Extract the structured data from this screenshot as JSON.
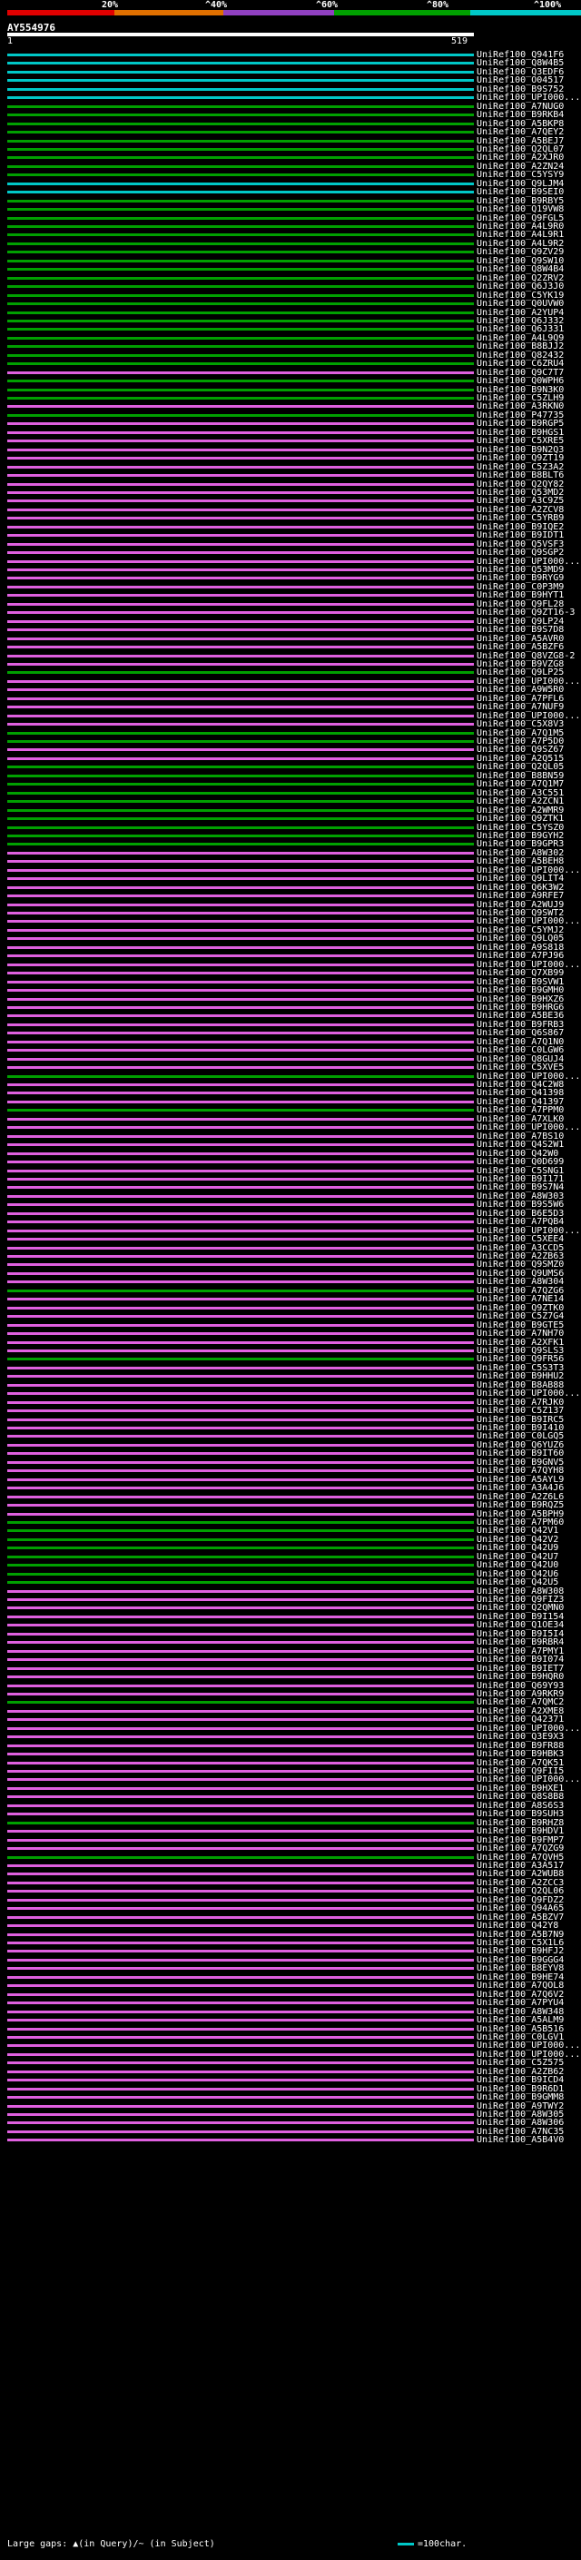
{
  "scale": {
    "labels": [
      "20%",
      "^40%",
      "^60%",
      "^80%",
      "^100%"
    ],
    "colors": [
      "#e00000",
      "#e07000",
      "#9040c0",
      "#00a000",
      "#00c8c8"
    ]
  },
  "query": {
    "name": "AY554976",
    "start": "1",
    "end": "519"
  },
  "hits": [
    {
      "label": "UniRef100_Q941F6",
      "color": "#00c8c8"
    },
    {
      "label": "UniRef100_Q8W4B5",
      "color": "#00c8c8"
    },
    {
      "label": "UniRef100_Q3EDF6",
      "color": "#00c8c8"
    },
    {
      "label": "UniRef100_O04517",
      "color": "#00c8c8"
    },
    {
      "label": "UniRef100_B9S752",
      "color": "#00c8c8"
    },
    {
      "label": "UniRef100_UPI000...",
      "color": "#00c8c8"
    },
    {
      "label": "UniRef100_A7NUG0",
      "color": "#00a000"
    },
    {
      "label": "UniRef100_B9RKB4",
      "color": "#00a000"
    },
    {
      "label": "UniRef100_A5BKP8",
      "color": "#00a000"
    },
    {
      "label": "UniRef100_A7QEY2",
      "color": "#00a000"
    },
    {
      "label": "UniRef100_A5BEJ7",
      "color": "#00a000"
    },
    {
      "label": "UniRef100_Q2QL07",
      "color": "#00a000"
    },
    {
      "label": "UniRef100_A2XJR0",
      "color": "#00a000"
    },
    {
      "label": "UniRef100_A2ZN24",
      "color": "#00a000"
    },
    {
      "label": "UniRef100_C5YSY9",
      "color": "#00a000"
    },
    {
      "label": "UniRef100_Q9LJM4",
      "color": "#00c8c8"
    },
    {
      "label": "UniRef100_B9SEI0",
      "color": "#00c8c8"
    },
    {
      "label": "UniRef100_B9RBY5",
      "color": "#00a000"
    },
    {
      "label": "UniRef100_Q19VW8",
      "color": "#00a000"
    },
    {
      "label": "UniRef100_Q9FGL5",
      "color": "#00a000"
    },
    {
      "label": "UniRef100_A4L9R0",
      "color": "#00a000"
    },
    {
      "label": "UniRef100_A4L9R1",
      "color": "#00a000"
    },
    {
      "label": "UniRef100_A4L9R2",
      "color": "#00a000"
    },
    {
      "label": "UniRef100_Q9ZV29",
      "color": "#00a000"
    },
    {
      "label": "UniRef100_Q9SW10",
      "color": "#00a000"
    },
    {
      "label": "UniRef100_Q8W4B4",
      "color": "#00a000"
    },
    {
      "label": "UniRef100_Q2ZRV2",
      "color": "#00a000"
    },
    {
      "label": "UniRef100_Q6J3J0",
      "color": "#00a000"
    },
    {
      "label": "UniRef100_C5YK19",
      "color": "#00a000"
    },
    {
      "label": "UniRef100_Q0UVW0",
      "color": "#00a000"
    },
    {
      "label": "UniRef100_A2YUP4",
      "color": "#00a000"
    },
    {
      "label": "UniRef100_Q6J332",
      "color": "#00a000"
    },
    {
      "label": "UniRef100_Q6J331",
      "color": "#00a000"
    },
    {
      "label": "UniRef100_A4L9Q9",
      "color": "#00a000"
    },
    {
      "label": "UniRef100_B8BJJ2",
      "color": "#00a000"
    },
    {
      "label": "UniRef100_Q82432",
      "color": "#00a000"
    },
    {
      "label": "UniRef100_C6ZRU4",
      "color": "#00a000"
    },
    {
      "label": "UniRef100_Q9C7T7",
      "color": "#e060e0"
    },
    {
      "label": "UniRef100_Q0WPH6",
      "color": "#00a000"
    },
    {
      "label": "UniRef100_B9N3K0",
      "color": "#00a000"
    },
    {
      "label": "UniRef100_C5ZLH9",
      "color": "#00a000"
    },
    {
      "label": "UniRef100_A3RKN0",
      "color": "#e060e0"
    },
    {
      "label": "UniRef100_P47735",
      "color": "#00a000"
    },
    {
      "label": "UniRef100_B9RGP5",
      "color": "#e060e0"
    },
    {
      "label": "UniRef100_B9HGS1",
      "color": "#e060e0"
    },
    {
      "label": "UniRef100_C5XRE5",
      "color": "#e060e0"
    },
    {
      "label": "UniRef100_B9N2Q3",
      "color": "#e060e0"
    },
    {
      "label": "UniRef100_Q9ZT19",
      "color": "#e060e0"
    },
    {
      "label": "UniRef100_C5Z3A2",
      "color": "#e060e0"
    },
    {
      "label": "UniRef100_B8BLT6",
      "color": "#e060e0"
    },
    {
      "label": "UniRef100_Q2QY82",
      "color": "#e060e0"
    },
    {
      "label": "UniRef100_Q53MD2",
      "color": "#e060e0"
    },
    {
      "label": "UniRef100_A3C9Z5",
      "color": "#e060e0"
    },
    {
      "label": "UniRef100_A2ZCV8",
      "color": "#e060e0"
    },
    {
      "label": "UniRef100_C5YRB9",
      "color": "#e060e0"
    },
    {
      "label": "UniRef100_B9IQE2",
      "color": "#e060e0"
    },
    {
      "label": "UniRef100_B9IDT1",
      "color": "#e060e0"
    },
    {
      "label": "UniRef100_Q5VSF3",
      "color": "#e060e0"
    },
    {
      "label": "UniRef100_Q9SGP2",
      "color": "#e060e0"
    },
    {
      "label": "UniRef100_UPI000...",
      "color": "#e060e0"
    },
    {
      "label": "UniRef100_Q53MD9",
      "color": "#e060e0"
    },
    {
      "label": "UniRef100_B9RYG9",
      "color": "#e060e0"
    },
    {
      "label": "UniRef100_C0P3M9",
      "color": "#e060e0"
    },
    {
      "label": "UniRef100_B9HYT1",
      "color": "#e060e0"
    },
    {
      "label": "UniRef100_Q9FL28",
      "color": "#e060e0"
    },
    {
      "label": "UniRef100_Q9ZT16-3",
      "color": "#e060e0"
    },
    {
      "label": "UniRef100_Q9LP24",
      "color": "#e060e0"
    },
    {
      "label": "UniRef100_B9S7D8",
      "color": "#e060e0"
    },
    {
      "label": "UniRef100_A5AVR0",
      "color": "#e060e0"
    },
    {
      "label": "UniRef100_A5BZF6",
      "color": "#e060e0"
    },
    {
      "label": "UniRef100_Q8VZG8-2",
      "color": "#e060e0"
    },
    {
      "label": "UniRef100_B9VZG8",
      "color": "#e060e0"
    },
    {
      "label": "UniRef100_Q9LP25",
      "color": "#00a000"
    },
    {
      "label": "UniRef100_UPI000...",
      "color": "#e060e0"
    },
    {
      "label": "UniRef100_A9W5R0",
      "color": "#e060e0"
    },
    {
      "label": "UniRef100_A7PFL6",
      "color": "#e060e0"
    },
    {
      "label": "UniRef100_A7NUF9",
      "color": "#e060e0"
    },
    {
      "label": "UniRef100_UPI000...",
      "color": "#e060e0"
    },
    {
      "label": "UniRef100_C5X8V3",
      "color": "#e060e0"
    },
    {
      "label": "UniRef100_A7Q1M5",
      "color": "#00a000"
    },
    {
      "label": "UniRef100_A7P5D0",
      "color": "#00a000"
    },
    {
      "label": "UniRef100_Q9SZ67",
      "color": "#e060e0"
    },
    {
      "label": "UniRef100_A2Q515",
      "color": "#e060e0"
    },
    {
      "label": "UniRef100_Q2QL05",
      "color": "#00a000"
    },
    {
      "label": "UniRef100_B8BN59",
      "color": "#00a000"
    },
    {
      "label": "UniRef100_A7Q1M7",
      "color": "#00a000"
    },
    {
      "label": "UniRef100_A3C551",
      "color": "#00a000"
    },
    {
      "label": "UniRef100_A2ZCN1",
      "color": "#00a000"
    },
    {
      "label": "UniRef100_A2WMR9",
      "color": "#00a000"
    },
    {
      "label": "UniRef100_Q9ZTK1",
      "color": "#00a000"
    },
    {
      "label": "UniRef100_C5YSZ0",
      "color": "#00a000"
    },
    {
      "label": "UniRef100_B9GYH2",
      "color": "#00a000"
    },
    {
      "label": "UniRef100_B9GPR3",
      "color": "#00a000"
    },
    {
      "label": "UniRef100_A8W302",
      "color": "#e060e0"
    },
    {
      "label": "UniRef100_A5BEH8",
      "color": "#e060e0"
    },
    {
      "label": "UniRef100_UPI000...",
      "color": "#e060e0"
    },
    {
      "label": "UniRef100_Q9LIT4",
      "color": "#e060e0"
    },
    {
      "label": "UniRef100_Q6K3W2",
      "color": "#e060e0"
    },
    {
      "label": "UniRef100_A9RFE7",
      "color": "#e060e0"
    },
    {
      "label": "UniRef100_A2WUJ9",
      "color": "#e060e0"
    },
    {
      "label": "UniRef100_Q9SWT2",
      "color": "#e060e0"
    },
    {
      "label": "UniRef100_UPI000...",
      "color": "#e060e0"
    },
    {
      "label": "UniRef100_C5YMJ2",
      "color": "#e060e0"
    },
    {
      "label": "UniRef100_Q9LQ05",
      "color": "#e060e0"
    },
    {
      "label": "UniRef100_A9S818",
      "color": "#e060e0"
    },
    {
      "label": "UniRef100_A7PJ96",
      "color": "#e060e0"
    },
    {
      "label": "UniRef100_UPI000...",
      "color": "#e060e0"
    },
    {
      "label": "UniRef100_Q7XB99",
      "color": "#e060e0"
    },
    {
      "label": "UniRef100_B9SVW1",
      "color": "#e060e0"
    },
    {
      "label": "UniRef100_B9GMH0",
      "color": "#e060e0"
    },
    {
      "label": "UniRef100_B9HXZ6",
      "color": "#e060e0"
    },
    {
      "label": "UniRef100_B9HRG6",
      "color": "#e060e0"
    },
    {
      "label": "UniRef100_A5BE36",
      "color": "#e060e0"
    },
    {
      "label": "UniRef100_B9FRB3",
      "color": "#e060e0"
    },
    {
      "label": "UniRef100_Q6S867",
      "color": "#e060e0"
    },
    {
      "label": "UniRef100_A7Q1N0",
      "color": "#e060e0"
    },
    {
      "label": "UniRef100_C0LGW6",
      "color": "#e060e0"
    },
    {
      "label": "UniRef100_Q8GUJ4",
      "color": "#e060e0"
    },
    {
      "label": "UniRef100_C5XVE5",
      "color": "#e060e0"
    },
    {
      "label": "UniRef100_UPI000...",
      "color": "#00a000"
    },
    {
      "label": "UniRef100_Q4C2W8",
      "color": "#e060e0"
    },
    {
      "label": "UniRef100_Q41398",
      "color": "#e060e0"
    },
    {
      "label": "UniRef100_Q41397",
      "color": "#e060e0"
    },
    {
      "label": "UniRef100_A7PPM0",
      "color": "#00a000"
    },
    {
      "label": "UniRef100_A7XLK0",
      "color": "#e060e0"
    },
    {
      "label": "UniRef100_UPI000...",
      "color": "#e060e0"
    },
    {
      "label": "UniRef100_A7BS10",
      "color": "#e060e0"
    },
    {
      "label": "UniRef100_Q4S2W1",
      "color": "#e060e0"
    },
    {
      "label": "UniRef100_Q42W0",
      "color": "#e060e0"
    },
    {
      "label": "UniRef100_Q0D699",
      "color": "#e060e0"
    },
    {
      "label": "UniRef100_C5SNG1",
      "color": "#e060e0"
    },
    {
      "label": "UniRef100_B9I171",
      "color": "#e060e0"
    },
    {
      "label": "UniRef100_B9S7N4",
      "color": "#e060e0"
    },
    {
      "label": "UniRef100_A8W303",
      "color": "#e060e0"
    },
    {
      "label": "UniRef100_B9S5W6",
      "color": "#e060e0"
    },
    {
      "label": "UniRef100_B6E5D3",
      "color": "#e060e0"
    },
    {
      "label": "UniRef100_A7PQB4",
      "color": "#e060e0"
    },
    {
      "label": "UniRef100_UPI000...",
      "color": "#e060e0"
    },
    {
      "label": "UniRef100_C5XEE4",
      "color": "#e060e0"
    },
    {
      "label": "UniRef100_A3CCD5",
      "color": "#e060e0"
    },
    {
      "label": "UniRef100_A2ZB63",
      "color": "#e060e0"
    },
    {
      "label": "UniRef100_Q9SMZ0",
      "color": "#e060e0"
    },
    {
      "label": "UniRef100_Q9UMS6",
      "color": "#e060e0"
    },
    {
      "label": "UniRef100_A8W304",
      "color": "#e060e0"
    },
    {
      "label": "UniRef100_A7QZG6",
      "color": "#00a000"
    },
    {
      "label": "UniRef100_A7NE14",
      "color": "#e060e0"
    },
    {
      "label": "UniRef100_Q9ZTK0",
      "color": "#e060e0"
    },
    {
      "label": "UniRef100_C5Z7G4",
      "color": "#e060e0"
    },
    {
      "label": "UniRef100_B9GTE5",
      "color": "#e060e0"
    },
    {
      "label": "UniRef100_A7NH70",
      "color": "#e060e0"
    },
    {
      "label": "UniRef100_A2XFK1",
      "color": "#e060e0"
    },
    {
      "label": "UniRef100_Q9SLS3",
      "color": "#e060e0"
    },
    {
      "label": "UniRef100_Q9FR56",
      "color": "#00a000"
    },
    {
      "label": "UniRef100_C5S3T3",
      "color": "#e060e0"
    },
    {
      "label": "UniRef100_B9HHU2",
      "color": "#e060e0"
    },
    {
      "label": "UniRef100_B8AB88",
      "color": "#e060e0"
    },
    {
      "label": "UniRef100_UPI000...",
      "color": "#e060e0"
    },
    {
      "label": "UniRef100_A7RJK0",
      "color": "#e060e0"
    },
    {
      "label": "UniRef100_C5Z137",
      "color": "#e060e0"
    },
    {
      "label": "UniRef100_B9IRC5",
      "color": "#e060e0"
    },
    {
      "label": "UniRef100_B9I410",
      "color": "#e060e0"
    },
    {
      "label": "UniRef100_C0LGQ5",
      "color": "#e060e0"
    },
    {
      "label": "UniRef100_Q6YUZ6",
      "color": "#e060e0"
    },
    {
      "label": "UniRef100_B9IT60",
      "color": "#e060e0"
    },
    {
      "label": "UniRef100_B9GNV5",
      "color": "#e060e0"
    },
    {
      "label": "UniRef100_A7QYH8",
      "color": "#e060e0"
    },
    {
      "label": "UniRef100_A5AYL9",
      "color": "#e060e0"
    },
    {
      "label": "UniRef100_A3A4J6",
      "color": "#e060e0"
    },
    {
      "label": "UniRef100_A2Z6L6",
      "color": "#e060e0"
    },
    {
      "label": "UniRef100_B9RQZ5",
      "color": "#e060e0"
    },
    {
      "label": "UniRef100_A5BPH9",
      "color": "#e060e0"
    },
    {
      "label": "UniRef100_A7PM60",
      "color": "#00a000"
    },
    {
      "label": "UniRef100_Q42V1",
      "color": "#00a000"
    },
    {
      "label": "UniRef100_Q42V2",
      "color": "#00a000"
    },
    {
      "label": "UniRef100_Q42U9",
      "color": "#00a000"
    },
    {
      "label": "UniRef100_Q42U7",
      "color": "#00a000"
    },
    {
      "label": "UniRef100_Q42U0",
      "color": "#00a000"
    },
    {
      "label": "UniRef100_Q42U6",
      "color": "#00a000"
    },
    {
      "label": "UniRef100_Q42U5",
      "color": "#00a000"
    },
    {
      "label": "UniRef100_A8W308",
      "color": "#e060e0"
    },
    {
      "label": "UniRef100_Q9FIZ3",
      "color": "#e060e0"
    },
    {
      "label": "UniRef100_Q2QMN0",
      "color": "#e060e0"
    },
    {
      "label": "UniRef100_B9I154",
      "color": "#e060e0"
    },
    {
      "label": "UniRef100_Q1OE34",
      "color": "#e060e0"
    },
    {
      "label": "UniRef100_B9I5I4",
      "color": "#e060e0"
    },
    {
      "label": "UniRef100_B9RBR4",
      "color": "#e060e0"
    },
    {
      "label": "UniRef100_A7PMY1",
      "color": "#e060e0"
    },
    {
      "label": "UniRef100_B9I074",
      "color": "#e060e0"
    },
    {
      "label": "UniRef100_B9IET7",
      "color": "#e060e0"
    },
    {
      "label": "UniRef100_B9HQR0",
      "color": "#e060e0"
    },
    {
      "label": "UniRef100_Q69Y93",
      "color": "#e060e0"
    },
    {
      "label": "UniRef100_A9RKR9",
      "color": "#e060e0"
    },
    {
      "label": "UniRef100_A7QMC2",
      "color": "#00a000"
    },
    {
      "label": "UniRef100_A2XME8",
      "color": "#e060e0"
    },
    {
      "label": "UniRef100_Q42371",
      "color": "#e060e0"
    },
    {
      "label": "UniRef100_UPI000...",
      "color": "#e060e0"
    },
    {
      "label": "UniRef100_Q3E9X3",
      "color": "#e060e0"
    },
    {
      "label": "UniRef100_B9FR88",
      "color": "#e060e0"
    },
    {
      "label": "UniRef100_B9HBK3",
      "color": "#e060e0"
    },
    {
      "label": "UniRef100_A7QK51",
      "color": "#e060e0"
    },
    {
      "label": "UniRef100_Q9FII5",
      "color": "#e060e0"
    },
    {
      "label": "UniRef100_UPI000...",
      "color": "#e060e0"
    },
    {
      "label": "UniRef100_B9HXE1",
      "color": "#e060e0"
    },
    {
      "label": "UniRef100_Q8S8B8",
      "color": "#e060e0"
    },
    {
      "label": "UniRef100_A8S6S3",
      "color": "#e060e0"
    },
    {
      "label": "UniRef100_B9SUH3",
      "color": "#e060e0"
    },
    {
      "label": "UniRef100_B9RHZ8",
      "color": "#00a000"
    },
    {
      "label": "UniRef100_B9HDV1",
      "color": "#e060e0"
    },
    {
      "label": "UniRef100_B9FMP7",
      "color": "#e060e0"
    },
    {
      "label": "UniRef100_A7QZG9",
      "color": "#e060e0"
    },
    {
      "label": "UniRef100_A7QVH5",
      "color": "#00a000"
    },
    {
      "label": "UniRef100_A3A517",
      "color": "#e060e0"
    },
    {
      "label": "UniRef100_A2WUB8",
      "color": "#e060e0"
    },
    {
      "label": "UniRef100_A2ZCC3",
      "color": "#e060e0"
    },
    {
      "label": "UniRef100_Q2QL06",
      "color": "#e060e0"
    },
    {
      "label": "UniRef100_Q9FDZ2",
      "color": "#e060e0"
    },
    {
      "label": "UniRef100_Q94A65",
      "color": "#e060e0"
    },
    {
      "label": "UniRef100_A5BZV7",
      "color": "#e060e0"
    },
    {
      "label": "UniRef100_Q42Y8",
      "color": "#e060e0"
    },
    {
      "label": "UniRef100_A5B7N9",
      "color": "#e060e0"
    },
    {
      "label": "UniRef100_C5X1L6",
      "color": "#e060e0"
    },
    {
      "label": "UniRef100_B9HFJ2",
      "color": "#e060e0"
    },
    {
      "label": "UniRef100_B9GGG4",
      "color": "#e060e0"
    },
    {
      "label": "UniRef100_B8EYV8",
      "color": "#e060e0"
    },
    {
      "label": "UniRef100_B9HE74",
      "color": "#e060e0"
    },
    {
      "label": "UniRef100_A7QOL8",
      "color": "#e060e0"
    },
    {
      "label": "UniRef100_A7Q6V2",
      "color": "#e060e0"
    },
    {
      "label": "UniRef100_A7PYU4",
      "color": "#e060e0"
    },
    {
      "label": "UniRef100_A8W348",
      "color": "#e060e0"
    },
    {
      "label": "UniRef100_A5ALM9",
      "color": "#e060e0"
    },
    {
      "label": "UniRef100_A5B516",
      "color": "#e060e0"
    },
    {
      "label": "UniRef100_C0LGV1",
      "color": "#e060e0"
    },
    {
      "label": "UniRef100_UPI000...",
      "color": "#e060e0"
    },
    {
      "label": "UniRef100_UPI000...",
      "color": "#e060e0"
    },
    {
      "label": "UniRef100_C5Z575",
      "color": "#e060e0"
    },
    {
      "label": "UniRef100_A2ZB62",
      "color": "#e060e0"
    },
    {
      "label": "UniRef100_B9ICD4",
      "color": "#e060e0"
    },
    {
      "label": "UniRef100_B9R6D1",
      "color": "#e060e0"
    },
    {
      "label": "UniRef100_B9GMM8",
      "color": "#e060e0"
    },
    {
      "label": "UniRef100_A9TWY2",
      "color": "#e060e0"
    },
    {
      "label": "UniRef100_A8W305",
      "color": "#e060e0"
    },
    {
      "label": "UniRef100_A8W306",
      "color": "#e060e0"
    },
    {
      "label": "UniRef100_A7NC35",
      "color": "#e060e0"
    },
    {
      "label": "UniRef100_A5B4V0",
      "color": "#e060e0"
    }
  ],
  "legend": {
    "gaps": "Large gaps: ▲(in Query)/~ (in Subject)",
    "scale": "=100char."
  }
}
